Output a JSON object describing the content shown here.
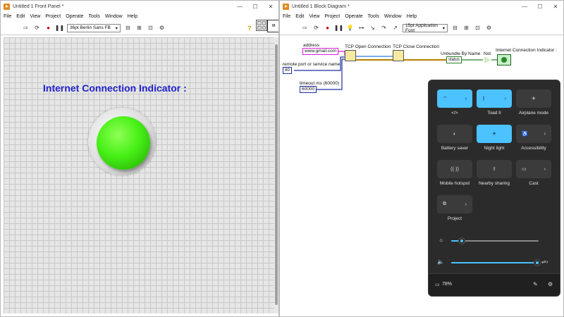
{
  "front_panel": {
    "title": "Untitled 1 Front Panel *",
    "menu": [
      "File",
      "Edit",
      "View",
      "Project",
      "Operate",
      "Tools",
      "Window",
      "Help"
    ],
    "font_select": "36pt Berlin Sans FB",
    "indicator_label": "Internet Connection Indicator :",
    "led_color": "#47f016"
  },
  "block_diagram": {
    "title": "Untitled 1 Block Diagram *",
    "menu": [
      "File",
      "Edit",
      "View",
      "Project",
      "Operate",
      "Tools",
      "Window",
      "Help"
    ],
    "font_select": "15pt Application Font",
    "labels": {
      "address": "address",
      "address_value": "www.gmail.com",
      "port_label": "remote port or service name",
      "port_value": "80",
      "timeout_label": "timeout ms (60000)",
      "timeout_value": "60000",
      "tcp_open": "TCP Open Connection",
      "tcp_close": "TCP Close Connection",
      "unbundle": "Unbundle By Name",
      "unbundle_field": "status",
      "not": "Not",
      "indicator": "Internet Connection Indicator :"
    }
  },
  "quick_settings": {
    "tiles": [
      {
        "label": "</>",
        "icon": "wifi-icon",
        "on": true,
        "split": true
      },
      {
        "label": "Toad II",
        "icon": "bluetooth-icon",
        "on": true,
        "split": true
      },
      {
        "label": "Airplane mode",
        "icon": "airplane-icon",
        "on": false,
        "split": false
      },
      {
        "label": "Battery saver",
        "icon": "battery-saver-icon",
        "on": false,
        "split": false
      },
      {
        "label": "Night light",
        "icon": "night-light-icon",
        "on": true,
        "split": false
      },
      {
        "label": "Accessibility",
        "icon": "accessibility-icon",
        "on": false,
        "split": true
      },
      {
        "label": "Mobile hotspot",
        "icon": "hotspot-icon",
        "on": false,
        "split": false
      },
      {
        "label": "Nearby sharing",
        "icon": "share-icon",
        "on": false,
        "split": false
      },
      {
        "label": "Cast",
        "icon": "cast-icon",
        "on": false,
        "split": true
      },
      {
        "label": "Project",
        "icon": "project-icon",
        "on": false,
        "split": true
      }
    ],
    "brightness": 0.12,
    "volume": 1.0,
    "battery": "78%",
    "accent": "#4cc2ff"
  }
}
